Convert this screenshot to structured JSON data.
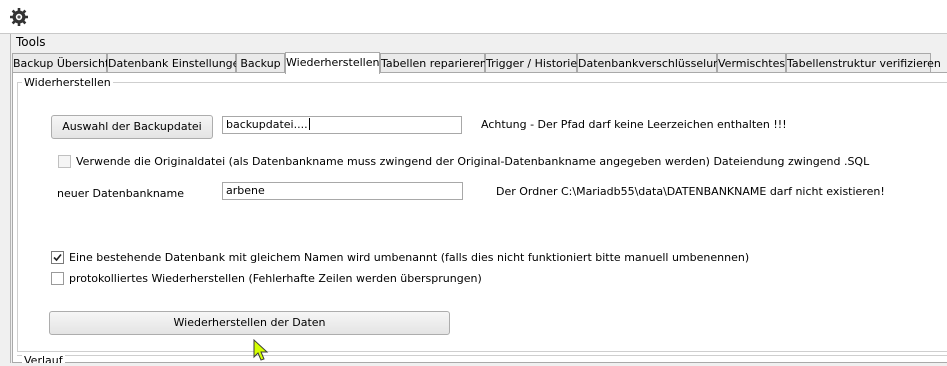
{
  "menu": {
    "tools": "Tools"
  },
  "tabs": [
    {
      "label": "Backup Übersicht"
    },
    {
      "label": "Datenbank Einstellungen"
    },
    {
      "label": "Backup"
    },
    {
      "label": "Wiederherstellen"
    },
    {
      "label": "Tabellen reparieren"
    },
    {
      "label": "Trigger / Historie"
    },
    {
      "label": "Datenbankverschlüsselung"
    },
    {
      "label": "Vermischtes"
    },
    {
      "label": "Tabellenstruktur verifizieren"
    }
  ],
  "active_tab": "Wiederherstellen",
  "restore": {
    "group_title": "Widerherstellen",
    "choose_backup_button": "Auswahl der Backupdatei",
    "backup_file_value": "backupdatei....",
    "path_warning": "Achtung -  Der Pfad darf keine Leerzeichen enthalten  !!!",
    "use_original_label": "Verwende die Originaldatei (als Datenbankname muss zwingend der Original-Datenbankname angegeben werden)  Dateiendung zwingend .SQL",
    "use_original_checked": false,
    "new_db_label": "neuer Datenbankname",
    "new_db_value": "arbene",
    "folder_warning": "Der Ordner C:\\Mariadb55\\data\\DATENBANKNAME  darf nicht existieren!",
    "rename_existing_label": "Eine bestehende Datenbank mit gleichem Namen wird umbenannt (falls dies nicht funktioniert bitte manuell umbenennen)",
    "rename_existing_checked": true,
    "logged_restore_label": "protokolliertes Wiederherstellen (Fehlerhafte Zeilen werden übersprungen)",
    "logged_restore_checked": false,
    "restore_button": "Wiederherstellen der Daten"
  },
  "log_group_title": "Verlauf",
  "colors": {
    "window_bg": "#f0f0f0",
    "panel_bg": "#ffffff",
    "border": "#a9a9a9",
    "cursor": "#d4ff00"
  }
}
